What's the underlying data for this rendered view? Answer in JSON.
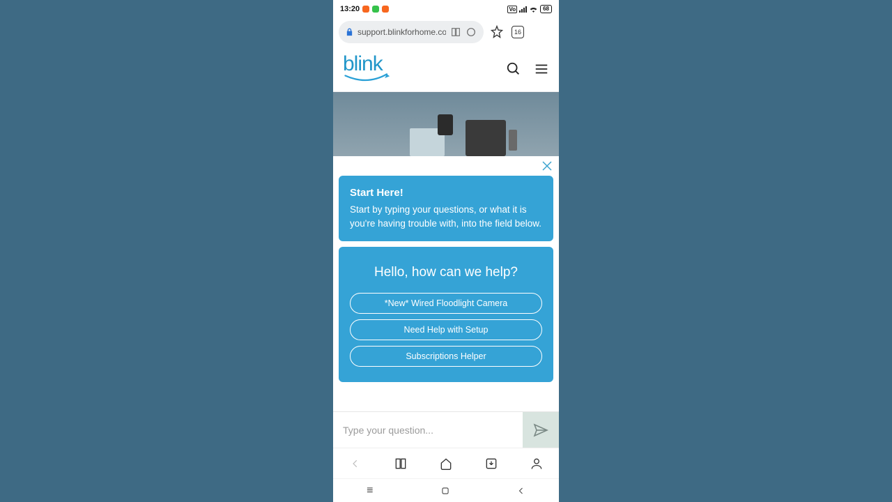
{
  "statusbar": {
    "time": "13:20",
    "battery": "68"
  },
  "browser": {
    "url": "support.blinkforhome.co",
    "tab_count": "16"
  },
  "site": {
    "logo_text": "blink"
  },
  "chat": {
    "start_card": {
      "title": "Start Here!",
      "body": "Start by typing your questions, or what it is you're having trouble with, into the field below."
    },
    "help_card": {
      "title": "Hello, how can we help?",
      "buttons": [
        "*New* Wired Floodlight Camera",
        "Need Help with Setup",
        "Subscriptions Helper"
      ]
    },
    "input_placeholder": "Type your question..."
  }
}
